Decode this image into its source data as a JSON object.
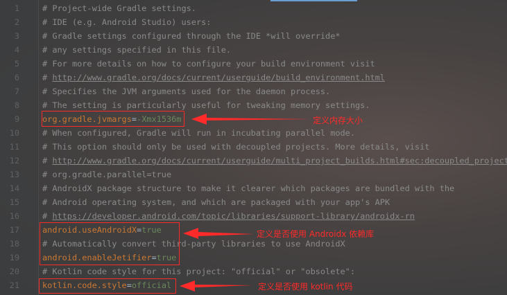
{
  "lines": [
    {
      "n": "1",
      "t": "# Project-wide Gradle settings."
    },
    {
      "n": "2",
      "t": "# IDE (e.g. Android Studio) users:"
    },
    {
      "n": "3",
      "t": "# Gradle settings configured through the IDE *will override*"
    },
    {
      "n": "4",
      "t": "# any settings specified in this file."
    },
    {
      "n": "5",
      "t": "# For more details on how to configure your build environment visit"
    },
    {
      "n": "6",
      "p": "# ",
      "u": "http://www.gradle.org/docs/current/userguide/build_environment.html"
    },
    {
      "n": "7",
      "t": "# Specifies the JVM arguments used for the daemon process."
    },
    {
      "n": "8",
      "t": "# The setting is particularly useful for tweaking memory settings."
    },
    {
      "n": "9",
      "k": "org.gradle.jvmargs",
      "v": "-Xmx1536m"
    },
    {
      "n": "10",
      "t": "# When configured, Gradle will run in incubating parallel mode."
    },
    {
      "n": "11",
      "t": "# This option should only be used with decoupled projects. More details, visit"
    },
    {
      "n": "12",
      "p": "# ",
      "u": "http://www.gradle.org/docs/current/userguide/multi_project_builds.html#sec:decoupled_projects"
    },
    {
      "n": "13",
      "t": "# org.gradle.parallel=true"
    },
    {
      "n": "14",
      "t": "# AndroidX package structure to make it clearer which packages are bundled with the"
    },
    {
      "n": "15",
      "t": "# Android operating system, and which are packaged with your app's APK"
    },
    {
      "n": "16",
      "p": "# ",
      "u": "https://developer.android.com/topic/libraries/support-library/androidx-rn"
    },
    {
      "n": "17",
      "k": "android.useAndroidX",
      "v": "true"
    },
    {
      "n": "18",
      "t": "# Automatically convert third-party libraries to use AndroidX"
    },
    {
      "n": "19",
      "k": "android.enableJetifier",
      "v": "true"
    },
    {
      "n": "20",
      "t": "# Kotlin code style for this project: \"official\" or \"obsolete\":"
    },
    {
      "n": "21",
      "k": "kotlin.code.style",
      "v": "official"
    }
  ],
  "eq": "=",
  "annotations": {
    "memory": "定义内存大小",
    "androidx": "定义是否使用 Androidx 依赖库",
    "kotlin": "定义是否使用 kotlin 代码"
  },
  "colors": {
    "comment": "#8a8a8a",
    "key": "#cc7832",
    "value": "#6a8759",
    "annotation": "#ff2a2a"
  }
}
